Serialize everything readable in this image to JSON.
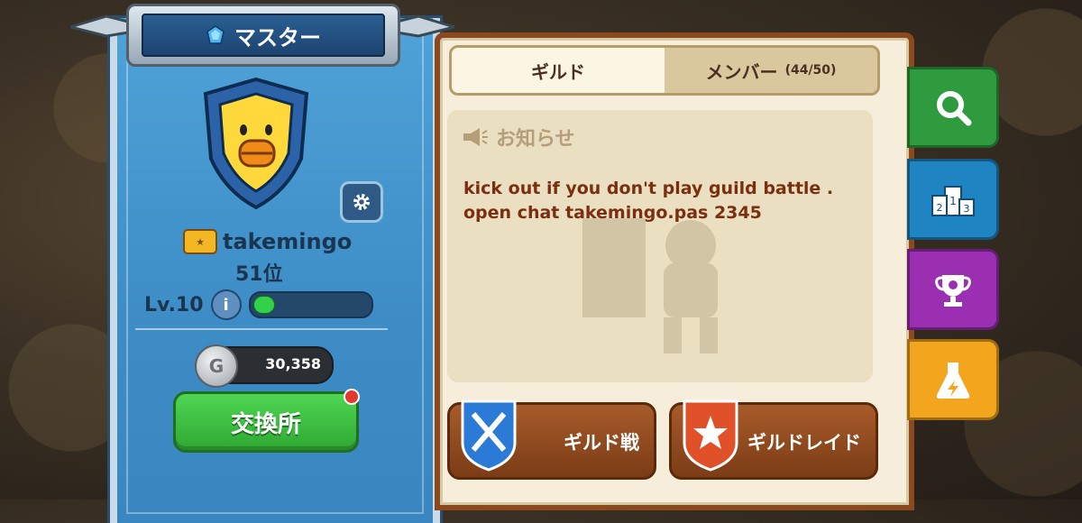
{
  "header": {
    "title": "マスター",
    "icon": "blue-gem-icon"
  },
  "profile": {
    "emblem": "sally-chick-shield-emblem",
    "rank_badge": "rank-badge-icon",
    "name": "takemingo",
    "rank": "51位",
    "level": "Lv.10",
    "xp_fraction": 0.12,
    "coins": "30,358",
    "coin_icon_letter": "G",
    "exchange_button": "交換所"
  },
  "tabs": [
    {
      "label": "ギルド",
      "active": true
    },
    {
      "label": "メンバー",
      "count": "(44/50)",
      "active": false
    }
  ],
  "notice": {
    "title": "お知らせ",
    "message_line1": "kick out if you don't play guild battle .",
    "message_line2": "open chat takemingo.pas 2345"
  },
  "actions": {
    "guild_war": "ギルド戦",
    "guild_raid": "ギルドレイド"
  },
  "side_tabs": [
    {
      "icon": "search-icon",
      "color": "#2e9c3e"
    },
    {
      "icon": "ranking-podium-icon",
      "color": "#1f84c2"
    },
    {
      "icon": "trophy-icon",
      "color": "#9b2fb2"
    },
    {
      "icon": "flask-icon",
      "color": "#f2a51d"
    }
  ],
  "colors": {
    "banner": "#4fa3d8",
    "book_border": "#8b4a1e",
    "exchange_green": "#3bbf3f"
  }
}
